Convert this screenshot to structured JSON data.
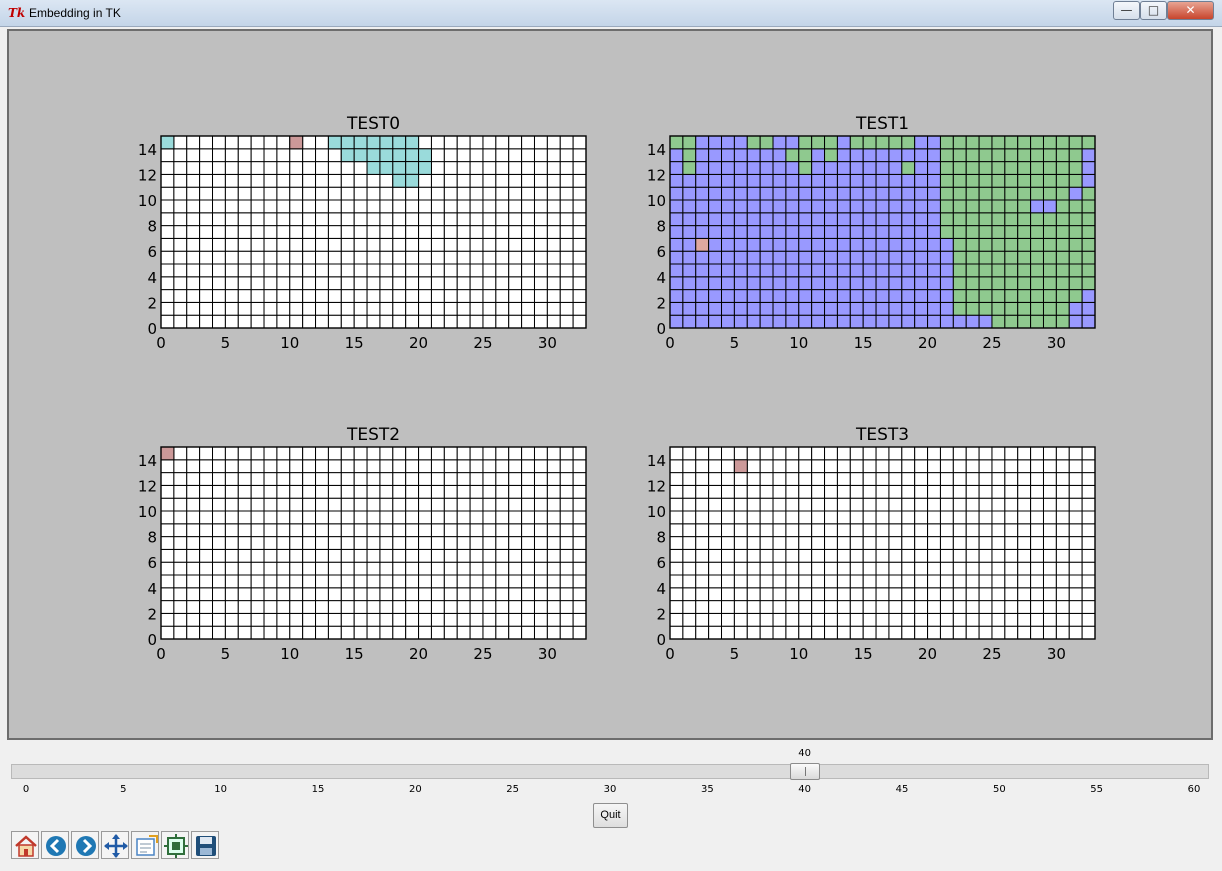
{
  "window": {
    "title": "Embedding in TK",
    "app_icon": "tk-feather-icon",
    "minimize": "—",
    "maximize": "□",
    "close": "✕"
  },
  "chart_data": [
    {
      "type": "heatmap",
      "title": "TEST0",
      "xlim": [
        0,
        33
      ],
      "ylim": [
        0,
        15
      ],
      "xticks": [
        "0",
        "5",
        "10",
        "15",
        "20",
        "25",
        "30"
      ],
      "yticks": [
        "0",
        "2",
        "4",
        "6",
        "8",
        "10",
        "12",
        "14"
      ],
      "default_color": "#ffffff",
      "cells": [
        {
          "x": 0,
          "y": 14,
          "color": "#9adbdb"
        },
        {
          "x": 10,
          "y": 14,
          "color": "#cc9999"
        },
        {
          "x": 13,
          "y": 14,
          "color": "#9adbdb"
        },
        {
          "x": 14,
          "y": 14,
          "color": "#9adbdb"
        },
        {
          "x": 15,
          "y": 14,
          "color": "#9adbdb"
        },
        {
          "x": 16,
          "y": 14,
          "color": "#9adbdb"
        },
        {
          "x": 17,
          "y": 14,
          "color": "#9adbdb"
        },
        {
          "x": 18,
          "y": 14,
          "color": "#9adbdb"
        },
        {
          "x": 19,
          "y": 14,
          "color": "#9adbdb"
        },
        {
          "x": 14,
          "y": 13,
          "color": "#9adbdb"
        },
        {
          "x": 15,
          "y": 13,
          "color": "#9adbdb"
        },
        {
          "x": 16,
          "y": 13,
          "color": "#9adbdb"
        },
        {
          "x": 17,
          "y": 13,
          "color": "#9adbdb"
        },
        {
          "x": 18,
          "y": 13,
          "color": "#9adbdb"
        },
        {
          "x": 19,
          "y": 13,
          "color": "#9adbdb"
        },
        {
          "x": 20,
          "y": 13,
          "color": "#9adbdb"
        },
        {
          "x": 16,
          "y": 12,
          "color": "#9adbdb"
        },
        {
          "x": 17,
          "y": 12,
          "color": "#9adbdb"
        },
        {
          "x": 18,
          "y": 12,
          "color": "#9adbdb"
        },
        {
          "x": 19,
          "y": 12,
          "color": "#9adbdb"
        },
        {
          "x": 20,
          "y": 12,
          "color": "#9adbdb"
        },
        {
          "x": 18,
          "y": 11,
          "color": "#9adbdb"
        },
        {
          "x": 19,
          "y": 11,
          "color": "#9adbdb"
        }
      ]
    },
    {
      "type": "heatmap",
      "title": "TEST1",
      "xlim": [
        0,
        33
      ],
      "ylim": [
        0,
        15
      ],
      "xticks": [
        "0",
        "5",
        "10",
        "15",
        "20",
        "25",
        "30"
      ],
      "yticks": [
        "0",
        "2",
        "4",
        "6",
        "8",
        "10",
        "12",
        "14"
      ],
      "colors": {
        "A": "#9999ff",
        "G": "#8fc98f",
        "R": "#dfa8a0"
      },
      "rows": [
        "GGAAAAGGAAGGGAGGGGGAAGGGGGGGGGGGG",
        "AGAAAAAAAGGAGAAAAAAAAGGGGGGGGGGGA",
        "AGAAAAAAAAGAAAAAAAGAAGGGGGGGGGGGA",
        "AAAAAAAAAAAAAAAAAAAAAGGGGGGGGGGGA",
        "AAAAAAAAAAAAAAAAAAAAAGGGGGGGGGGAG",
        "AAAAAAAAAAAAAAAAAAAAAGGGGGGGAAGGG",
        "AAAAAAAAAAAAAAAAAAAAAGGGGGGGGGGGG",
        "AAAAAAAAAAAAAAAAAAAAAGGGGGGGGGGGG",
        "AARAAAAAAAAAAAAAAAAAAAGGGGGGGGGGG",
        "AAAAAAAAAAAAAAAAAAAAAAGGGGGGGGGGG",
        "AAAAAAAAAAAAAAAAAAAAAAGGGGGGGGGGG",
        "AAAAAAAAAAAAAAAAAAAAAAGGGGGGGGGGG",
        "AAAAAAAAAAAAAAAAAAAAAAGGGGGGGGGGA",
        "AAAAAAAAAAAAAAAAAAAAAAGGGGGGGGGAA",
        "AAAAAAAAAAAAAAAAAAAAAAAAAGGGGGGAA"
      ]
    },
    {
      "type": "heatmap",
      "title": "TEST2",
      "xlim": [
        0,
        33
      ],
      "ylim": [
        0,
        15
      ],
      "xticks": [
        "0",
        "5",
        "10",
        "15",
        "20",
        "25",
        "30"
      ],
      "yticks": [
        "0",
        "2",
        "4",
        "6",
        "8",
        "10",
        "12",
        "14"
      ],
      "default_color": "#ffffff",
      "cells": [
        {
          "x": 0,
          "y": 14,
          "color": "#cc9999"
        }
      ]
    },
    {
      "type": "heatmap",
      "title": "TEST3",
      "xlim": [
        0,
        33
      ],
      "ylim": [
        0,
        15
      ],
      "xticks": [
        "0",
        "5",
        "10",
        "15",
        "20",
        "25",
        "30"
      ],
      "yticks": [
        "0",
        "2",
        "4",
        "6",
        "8",
        "10",
        "12",
        "14"
      ],
      "default_color": "#ffffff",
      "cells": [
        {
          "x": 5,
          "y": 13,
          "color": "#cc9999"
        }
      ]
    }
  ],
  "slider": {
    "value": 40,
    "value_label": "40",
    "min": 0,
    "max": 60,
    "ticks": [
      "0",
      "5",
      "10",
      "15",
      "20",
      "25",
      "30",
      "35",
      "40",
      "45",
      "50",
      "55",
      "60"
    ]
  },
  "quit": {
    "label": "Quit"
  },
  "toolbar": {
    "buttons": [
      {
        "name": "home-icon",
        "color": "#c0392b"
      },
      {
        "name": "back-arrow-icon",
        "color": "#1f78b4"
      },
      {
        "name": "forward-arrow-icon",
        "color": "#1f78b4"
      },
      {
        "name": "pan-icon",
        "color": "#1f5aa6"
      },
      {
        "name": "zoom-icon",
        "color": "#4a84c4"
      },
      {
        "name": "subplots-icon",
        "color": "#2f6e3b"
      },
      {
        "name": "save-icon",
        "color": "#1f4e79"
      }
    ]
  }
}
